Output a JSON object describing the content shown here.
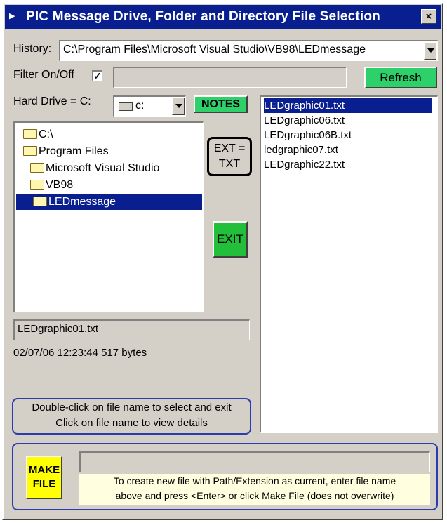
{
  "window": {
    "title": "PIC Message Drive, Folder and Directory File Selection",
    "close_glyph": "×"
  },
  "history": {
    "label": "History:",
    "value": "C:\\Program Files\\Microsoft Visual Studio\\VB98\\LEDmessage"
  },
  "filter": {
    "label": "Filter On/Off",
    "checked_glyph": "✓",
    "value": ""
  },
  "refresh_button": {
    "label": "Refresh"
  },
  "drive": {
    "label": "Hard Drive = C:",
    "value": "c:"
  },
  "notes_button": {
    "label": "NOTES"
  },
  "ext_label": {
    "line1": "EXT =",
    "line2": "TXT"
  },
  "exit_button": {
    "label": "EXIT"
  },
  "folders": [
    {
      "name": "C:\\"
    },
    {
      "name": "Program Files"
    },
    {
      "name": "Microsoft Visual Studio"
    },
    {
      "name": "VB98"
    },
    {
      "name": "LEDmessage"
    }
  ],
  "files": [
    {
      "name": "LEDgraphic01.txt"
    },
    {
      "name": "LEDgraphic06.txt"
    },
    {
      "name": "LEDgraphic06B.txt"
    },
    {
      "name": "ledgraphic07.txt"
    },
    {
      "name": "LEDgraphic22.txt"
    }
  ],
  "selected_file": {
    "name": "LEDgraphic01.txt",
    "details": "02/07/06 12:23:44 517 bytes"
  },
  "instructions": {
    "line1": "Double-click on file name to select and exit",
    "line2": "Click on file name to view details"
  },
  "make_file": {
    "button_line1": "MAKE",
    "button_line2": "FILE",
    "input_value": "",
    "hint_line1": "To create new file with Path/Extension as current, enter file name",
    "hint_line2": "above and press <Enter> or click Make File  (does not overwrite)"
  },
  "colors": {
    "titlebar": "#0a1f8f",
    "selection": "#0a1f8f",
    "button_green": "#2ed06a",
    "exit_green": "#22c03a",
    "make_yellow": "#ffff00",
    "frame_blue": "#2a3cae"
  }
}
